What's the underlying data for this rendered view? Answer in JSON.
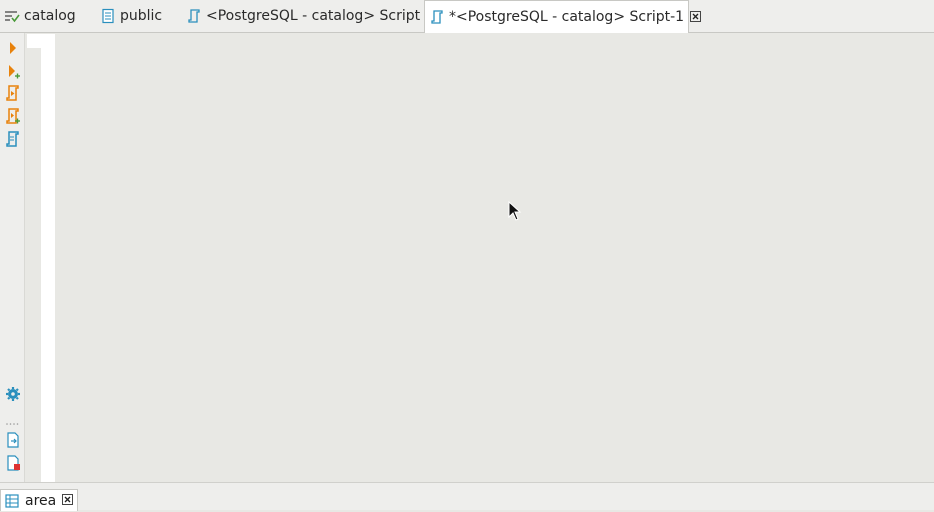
{
  "tabs": [
    {
      "label": "catalog",
      "icon": "sql-editor-icon",
      "active": false
    },
    {
      "label": "public",
      "icon": "schema-icon",
      "active": false
    },
    {
      "label": "<PostgreSQL - catalog> Script",
      "icon": "script-icon",
      "active": false
    },
    {
      "label": "*<PostgreSQL - catalog> Script-1",
      "icon": "script-icon",
      "active": true
    }
  ],
  "toolbar": {
    "items": [
      "execute-statement-icon",
      "execute-in-new-tab-icon",
      "execute-script-icon",
      "execute-script-new-tab-icon",
      "explain-plan-icon",
      "settings-icon",
      "export-icon",
      "close-results-icon"
    ]
  },
  "bottom": {
    "tab_label": "area",
    "tab_icon": "table-icon"
  },
  "colors": {
    "orange": "#e8820c",
    "teal": "#2a8fbd",
    "green": "#4a9a3a"
  }
}
